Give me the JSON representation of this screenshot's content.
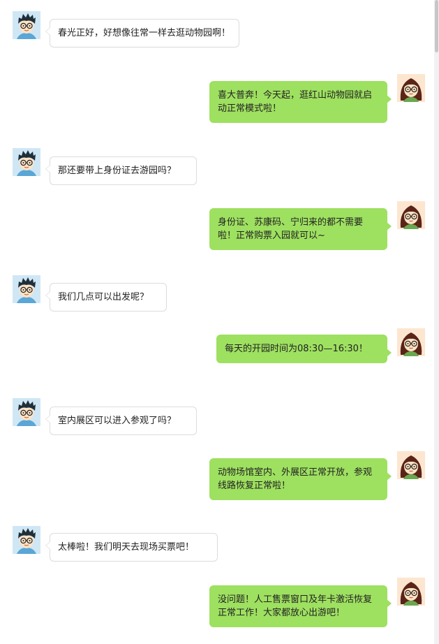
{
  "colors": {
    "left_bubble_bg": "#ffffff",
    "left_bubble_border": "#dcdcdc",
    "right_bubble_bg": "#9ee060",
    "page_bg": "#ffffff"
  },
  "participants": {
    "boy": {
      "icon": "boy-avatar-icon"
    },
    "girl": {
      "icon": "girl-avatar-icon"
    }
  },
  "messages": [
    {
      "side": "left",
      "sender": "boy",
      "text": "春光正好，好想像往常一样去逛动物园啊！"
    },
    {
      "side": "right",
      "sender": "girl",
      "text": "喜大普奔！今天起，逛红山动物园就启动正常模式啦！"
    },
    {
      "side": "left",
      "sender": "boy",
      "text": "那还要带上身份证去游园吗？"
    },
    {
      "side": "right",
      "sender": "girl",
      "text": "身份证、苏康码、宁归来的都不需要啦！正常购票入园就可以~"
    },
    {
      "side": "left",
      "sender": "boy",
      "text": "我们几点可以出发呢？"
    },
    {
      "side": "right",
      "sender": "girl",
      "text": "每天的开园时间为08:30—16:30！"
    },
    {
      "side": "left",
      "sender": "boy",
      "text": "室内展区可以进入参观了吗？"
    },
    {
      "side": "right",
      "sender": "girl",
      "text": "动物场馆室内、外展区正常开放，参观线路恢复正常啦！"
    },
    {
      "side": "left",
      "sender": "boy",
      "text": "太棒啦！我们明天去现场买票吧！"
    },
    {
      "side": "right",
      "sender": "girl",
      "text": "没问题！人工售票窗口及年卡激活恢复正常工作！大家都放心出游吧！"
    }
  ]
}
